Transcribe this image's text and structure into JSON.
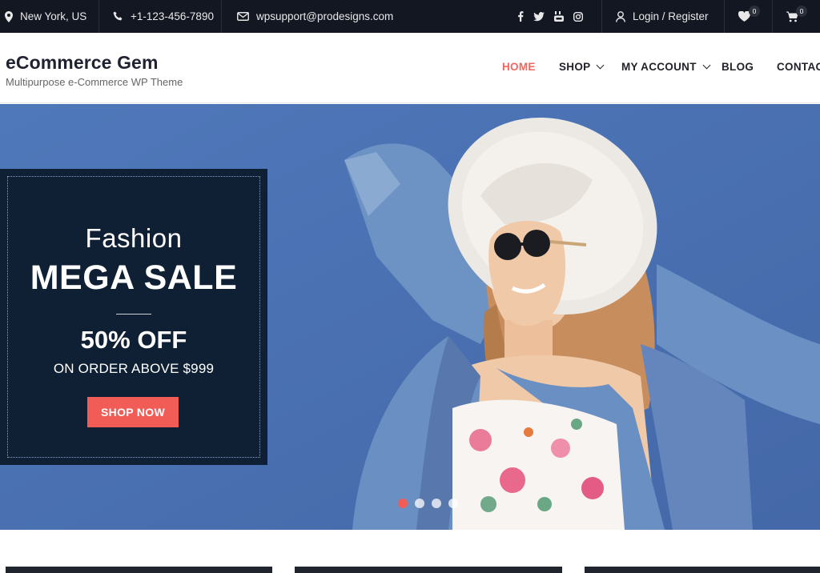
{
  "topbar": {
    "location": "New York, US",
    "phone": "+1-123-456-7890",
    "email": "wpsupport@prodesigns.com",
    "social_icons": [
      "facebook-icon",
      "twitter-icon",
      "youtube-icon",
      "instagram-icon"
    ],
    "login_label": "Login / Register",
    "wishlist_count": "0",
    "cart_count": "0"
  },
  "header": {
    "site_title": "eCommerce Gem",
    "tagline": "Multipurpose e-Commerce WP Theme",
    "nav": {
      "home": "HOME",
      "shop": "SHOP",
      "my_account": "MY ACCOUNT",
      "blog": "BLOG",
      "contact": "CONTACT"
    },
    "active_color": "#f2665e"
  },
  "hero": {
    "fashion": "Fashion",
    "headline": "MEGA SALE",
    "discount": "50% OFF",
    "condition": "ON ORDER ABOVE $999",
    "button": "SHOP NOW",
    "slide_count": 4,
    "active_slide": 1,
    "background_color": "#4a72b3",
    "panel_color": "#0f2034",
    "button_color": "#f25c57"
  }
}
